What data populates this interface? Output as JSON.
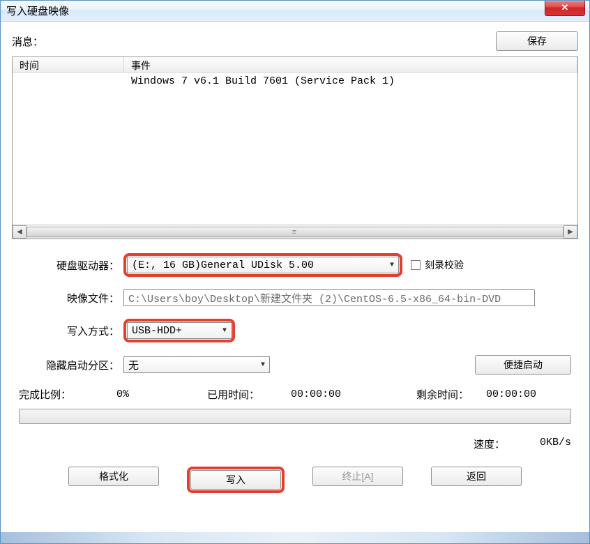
{
  "window": {
    "title": "写入硬盘映像"
  },
  "top": {
    "messages_label": "消息：",
    "save_btn": "保存"
  },
  "log": {
    "col_time": "时间",
    "col_event": "事件",
    "rows": [
      {
        "time": "",
        "event": "Windows 7 v6.1 Build 7601 (Service Pack 1)"
      }
    ]
  },
  "form": {
    "drive_label": "硬盘驱动器：",
    "drive_value": "(E:, 16 GB)General UDisk          5.00",
    "verify_label": "刻录校验",
    "image_label": "映像文件：",
    "image_value": "C:\\Users\\boy\\Desktop\\新建文件夹 (2)\\CentOS-6.5-x86_64-bin-DVD",
    "write_mode_label": "写入方式：",
    "write_mode_value": "USB-HDD+",
    "hide_label": "隐藏启动分区：",
    "hide_value": "无",
    "quick_boot_btn": "便捷启动"
  },
  "progress": {
    "complete_label": "完成比例：",
    "complete_value": "0%",
    "elapsed_label": "已用时间：",
    "elapsed_value": "00:00:00",
    "remaining_label": "剩余时间：",
    "remaining_value": "00:00:00",
    "speed_label": "速度：",
    "speed_value": "0KB/s"
  },
  "buttons": {
    "format": "格式化",
    "write": "写入",
    "abort": "终止[A]",
    "back": "返回"
  }
}
